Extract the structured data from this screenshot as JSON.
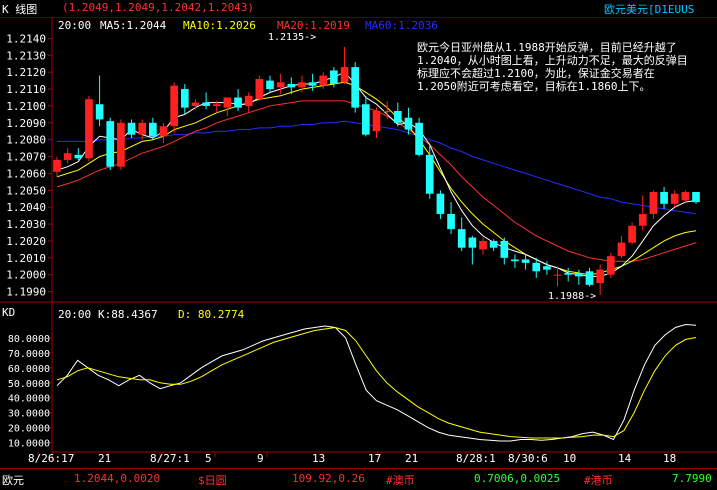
{
  "window": {
    "title": "K 线图",
    "ohlc_readout": "(1.2049,1.2049,1.2042,1.2043)",
    "symbol": "欧元美元[D1EUUS"
  },
  "main_panel": {
    "time_label": "20:00",
    "ma5_label": "MA5:1.2044",
    "ma10_label": "MA10:1.2026",
    "ma20_label": "MA20:1.2019",
    "ma60_label": "MA60:1.2036",
    "high_annotation": "1.2135->",
    "low_annotation": "1.1988->",
    "note": "欧元今日亚州盘从1.1988开始反弹，目前已经升越了1.2040，从小时图上看，上升动力不足，最大的反弹目标理应不会超过1.2100，为此，保证金交易者在1.2050附近可考虑看空，目标在1.1860上下。"
  },
  "kd_panel": {
    "title": "KD",
    "time_label": "20:00",
    "k_label": "K:88.4367",
    "d_label": "D: 80.2774"
  },
  "x_axis_labels": [
    "8/26:17",
    "21",
    "8/27:1",
    "5",
    "9",
    "13",
    "17",
    "21",
    "8/28:1",
    "8/30:6",
    "10",
    "14",
    "18"
  ],
  "status_bar": {
    "items": [
      {
        "name": "欧元",
        "value": "1.2044,0.0020",
        "color": "#ff3030"
      },
      {
        "name": "$日圆",
        "value": "109.92,0.26",
        "color": "#ff3030"
      },
      {
        "name": "#澳币",
        "value": "0.7006,0.0025",
        "color": "#30ff30"
      },
      {
        "name": "#港币",
        "value": "7.7990",
        "color": "#30ff30"
      }
    ]
  },
  "colors": {
    "up": "#ff2020",
    "down": "#20ffff",
    "ma5": "#ffffff",
    "ma10": "#ffff00",
    "ma20": "#ff3030",
    "ma60": "#2030ff",
    "axis": "#a00000"
  },
  "chart_data": [
    {
      "type": "candlestick",
      "title": "K 线图",
      "y_ticks": [
        1.214,
        1.213,
        1.212,
        1.211,
        1.21,
        1.209,
        1.208,
        1.207,
        1.206,
        1.205,
        1.204,
        1.203,
        1.202,
        1.201,
        1.2,
        1.199
      ],
      "ylim": [
        1.1985,
        1.2145
      ],
      "candles": [
        {
          "o": 1.2061,
          "h": 1.207,
          "l": 1.2058,
          "c": 1.2068
        },
        {
          "o": 1.2068,
          "h": 1.2075,
          "l": 1.2066,
          "c": 1.2072
        },
        {
          "o": 1.2071,
          "h": 1.2075,
          "l": 1.2068,
          "c": 1.2069
        },
        {
          "o": 1.2069,
          "h": 1.2106,
          "l": 1.2067,
          "c": 1.2104
        },
        {
          "o": 1.2101,
          "h": 1.2118,
          "l": 1.2088,
          "c": 1.2092
        },
        {
          "o": 1.2091,
          "h": 1.2093,
          "l": 1.2062,
          "c": 1.2064
        },
        {
          "o": 1.2064,
          "h": 1.2092,
          "l": 1.2062,
          "c": 1.209
        },
        {
          "o": 1.209,
          "h": 1.2092,
          "l": 1.2081,
          "c": 1.2083
        },
        {
          "o": 1.2083,
          "h": 1.2092,
          "l": 1.208,
          "c": 1.209
        },
        {
          "o": 1.209,
          "h": 1.2093,
          "l": 1.208,
          "c": 1.2082
        },
        {
          "o": 1.2082,
          "h": 1.209,
          "l": 1.2078,
          "c": 1.2088
        },
        {
          "o": 1.2088,
          "h": 1.2114,
          "l": 1.2084,
          "c": 1.2112
        },
        {
          "o": 1.211,
          "h": 1.2113,
          "l": 1.2095,
          "c": 1.2099
        },
        {
          "o": 1.21,
          "h": 1.2104,
          "l": 1.2098,
          "c": 1.2102
        },
        {
          "o": 1.2102,
          "h": 1.2108,
          "l": 1.2098,
          "c": 1.21
        },
        {
          "o": 1.21,
          "h": 1.2103,
          "l": 1.2096,
          "c": 1.2101
        },
        {
          "o": 1.2099,
          "h": 1.2104,
          "l": 1.2094,
          "c": 1.2105
        },
        {
          "o": 1.2105,
          "h": 1.211,
          "l": 1.2097,
          "c": 1.2099
        },
        {
          "o": 1.21,
          "h": 1.2108,
          "l": 1.2096,
          "c": 1.2106
        },
        {
          "o": 1.2104,
          "h": 1.2118,
          "l": 1.2103,
          "c": 1.2116
        },
        {
          "o": 1.2115,
          "h": 1.2118,
          "l": 1.2108,
          "c": 1.211
        },
        {
          "o": 1.2111,
          "h": 1.2119,
          "l": 1.2107,
          "c": 1.2114
        },
        {
          "o": 1.2113,
          "h": 1.2117,
          "l": 1.2107,
          "c": 1.2111
        },
        {
          "o": 1.2111,
          "h": 1.2118,
          "l": 1.2108,
          "c": 1.2114
        },
        {
          "o": 1.2114,
          "h": 1.2119,
          "l": 1.2109,
          "c": 1.2112
        },
        {
          "o": 1.2112,
          "h": 1.212,
          "l": 1.211,
          "c": 1.2118
        },
        {
          "o": 1.2121,
          "h": 1.2123,
          "l": 1.2111,
          "c": 1.2113
        },
        {
          "o": 1.2114,
          "h": 1.2135,
          "l": 1.2113,
          "c": 1.2123
        },
        {
          "o": 1.2123,
          "h": 1.2126,
          "l": 1.2096,
          "c": 1.2099
        },
        {
          "o": 1.2101,
          "h": 1.2106,
          "l": 1.2082,
          "c": 1.2083
        },
        {
          "o": 1.2085,
          "h": 1.2099,
          "l": 1.2081,
          "c": 1.2097
        },
        {
          "o": 1.2097,
          "h": 1.2103,
          "l": 1.2092,
          "c": 1.2097
        },
        {
          "o": 1.2097,
          "h": 1.2102,
          "l": 1.2088,
          "c": 1.209
        },
        {
          "o": 1.2093,
          "h": 1.2099,
          "l": 1.2083,
          "c": 1.2086
        },
        {
          "o": 1.209,
          "h": 1.2093,
          "l": 1.207,
          "c": 1.2071
        },
        {
          "o": 1.2071,
          "h": 1.2077,
          "l": 1.2045,
          "c": 1.2048
        },
        {
          "o": 1.2048,
          "h": 1.205,
          "l": 1.2033,
          "c": 1.2036
        },
        {
          "o": 1.2036,
          "h": 1.2043,
          "l": 1.2024,
          "c": 1.2027
        },
        {
          "o": 1.2027,
          "h": 1.2034,
          "l": 1.2014,
          "c": 1.2016
        },
        {
          "o": 1.2022,
          "h": 1.2023,
          "l": 1.2006,
          "c": 1.2016
        },
        {
          "o": 1.2015,
          "h": 1.2022,
          "l": 1.2012,
          "c": 1.202
        },
        {
          "o": 1.202,
          "h": 1.2021,
          "l": 1.2014,
          "c": 1.2016
        },
        {
          "o": 1.202,
          "h": 1.2022,
          "l": 1.2006,
          "c": 1.201
        },
        {
          "o": 1.2009,
          "h": 1.2012,
          "l": 1.2004,
          "c": 1.2008
        },
        {
          "o": 1.2009,
          "h": 1.2012,
          "l": 1.2003,
          "c": 1.2007
        },
        {
          "o": 1.2007,
          "h": 1.201,
          "l": 1.1998,
          "c": 1.2002
        },
        {
          "o": 1.2005,
          "h": 1.2008,
          "l": 1.2,
          "c": 1.2003
        },
        {
          "o": 1.2,
          "h": 1.2005,
          "l": 1.1993,
          "c": 1.2
        },
        {
          "o": 1.2001,
          "h": 1.2004,
          "l": 1.1996,
          "c": 1.2
        },
        {
          "o": 1.2001,
          "h": 1.2003,
          "l": 1.1994,
          "c": 1.1999
        },
        {
          "o": 1.2002,
          "h": 1.2004,
          "l": 1.1993,
          "c": 1.1994
        },
        {
          "o": 1.1995,
          "h": 1.2006,
          "l": 1.1988,
          "c": 1.2003
        },
        {
          "o": 1.2,
          "h": 1.2013,
          "l": 1.1998,
          "c": 1.2011
        },
        {
          "o": 1.2011,
          "h": 1.2023,
          "l": 1.201,
          "c": 1.2019
        },
        {
          "o": 1.2019,
          "h": 1.2031,
          "l": 1.2018,
          "c": 1.2029
        },
        {
          "o": 1.2029,
          "h": 1.2047,
          "l": 1.2026,
          "c": 1.2036
        },
        {
          "o": 1.2036,
          "h": 1.205,
          "l": 1.2033,
          "c": 1.2049
        },
        {
          "o": 1.2049,
          "h": 1.2052,
          "l": 1.2039,
          "c": 1.2042
        },
        {
          "o": 1.2042,
          "h": 1.205,
          "l": 1.204,
          "c": 1.2048
        },
        {
          "o": 1.2044,
          "h": 1.205,
          "l": 1.2042,
          "c": 1.2049
        },
        {
          "o": 1.2049,
          "h": 1.2049,
          "l": 1.2042,
          "c": 1.2043
        }
      ],
      "ma5": [
        1.2062,
        1.2064,
        1.2067,
        1.2076,
        1.2082,
        1.2081,
        1.208,
        1.2086,
        1.2083,
        1.2081,
        1.2085,
        1.2093,
        1.2095,
        1.2099,
        1.2102,
        1.2102,
        1.2102,
        1.2101,
        1.2101,
        1.2105,
        1.2108,
        1.211,
        1.2112,
        1.2113,
        1.2113,
        1.2115,
        1.2117,
        1.212,
        1.2113,
        1.2105,
        1.2101,
        1.2095,
        1.2089,
        1.209,
        1.2086,
        1.2077,
        1.2063,
        1.2049,
        1.2038,
        1.2029,
        1.2023,
        1.2019,
        1.2016,
        1.2014,
        1.2012,
        1.2009,
        1.2006,
        1.2004,
        1.2001,
        1.2,
        1.1999,
        1.1999,
        1.2001,
        1.2005,
        1.2011,
        1.202,
        1.2029,
        1.2035,
        1.204,
        1.2043,
        1.2044
      ],
      "ma10": [
        1.2058,
        1.206,
        1.2062,
        1.2066,
        1.207,
        1.2072,
        1.2073,
        1.2076,
        1.2079,
        1.208,
        1.2082,
        1.2086,
        1.2088,
        1.209,
        1.2093,
        1.2096,
        1.2098,
        1.21,
        1.2102,
        1.2104,
        1.2105,
        1.2106,
        1.2108,
        1.211,
        1.2111,
        1.2112,
        1.2113,
        1.2114,
        1.2112,
        1.2108,
        1.2104,
        1.2099,
        1.2093,
        1.2088,
        1.208,
        1.2071,
        1.2061,
        1.2051,
        1.2043,
        1.2036,
        1.203,
        1.2025,
        1.202,
        1.2016,
        1.2012,
        1.2009,
        1.2006,
        1.2004,
        1.2002,
        1.2001,
        1.2,
        1.2001,
        1.2003,
        1.2005,
        1.2008,
        1.2012,
        1.2016,
        1.202,
        1.2023,
        1.2025,
        1.2026
      ],
      "ma20": [
        1.2052,
        1.2054,
        1.2056,
        1.2059,
        1.2062,
        1.2064,
        1.2066,
        1.2069,
        1.2072,
        1.2074,
        1.2076,
        1.2079,
        1.2082,
        1.2085,
        1.2087,
        1.209,
        1.2092,
        1.2094,
        1.2096,
        1.2098,
        1.21,
        1.2101,
        1.2102,
        1.2103,
        1.2103,
        1.2103,
        1.2103,
        1.2103,
        1.2101,
        1.2099,
        1.2097,
        1.2094,
        1.209,
        1.2086,
        1.2082,
        1.2077,
        1.2071,
        1.2065,
        1.2058,
        1.2052,
        1.2046,
        1.2041,
        1.2036,
        1.2031,
        1.2027,
        1.2023,
        1.202,
        1.2017,
        1.2014,
        1.2012,
        1.201,
        1.2009,
        1.2008,
        1.2008,
        1.2008,
        1.2009,
        1.2011,
        1.2013,
        1.2015,
        1.2017,
        1.2019
      ],
      "ma60": [
        1.2079,
        1.2079,
        1.2079,
        1.2079,
        1.208,
        1.208,
        1.208,
        1.2081,
        1.2081,
        1.2082,
        1.2082,
        1.2083,
        1.2083,
        1.2084,
        1.2084,
        1.2085,
        1.2085,
        1.2086,
        1.2086,
        1.2087,
        1.2087,
        1.2088,
        1.2088,
        1.2089,
        1.2089,
        1.209,
        1.209,
        1.2091,
        1.209,
        1.2089,
        1.2088,
        1.2087,
        1.2086,
        1.2084,
        1.2082,
        1.208,
        1.2078,
        1.2075,
        1.2073,
        1.207,
        1.2068,
        1.2066,
        1.2064,
        1.2062,
        1.206,
        1.2058,
        1.2056,
        1.2054,
        1.2052,
        1.205,
        1.2048,
        1.2046,
        1.2045,
        1.2043,
        1.2042,
        1.2041,
        1.204,
        1.2039,
        1.2038,
        1.2037,
        1.2036
      ]
    },
    {
      "type": "line",
      "title": "KD",
      "y_ticks": [
        80,
        70,
        60,
        50,
        40,
        30,
        20,
        10
      ],
      "ylim": [
        5,
        92
      ],
      "series": [
        {
          "name": "K",
          "color": "#ffffff",
          "values": [
            48,
            55,
            65,
            60,
            55,
            52,
            48,
            52,
            55,
            50,
            46,
            48,
            50,
            55,
            60,
            64,
            68,
            70,
            72,
            75,
            78,
            80,
            82,
            84,
            86,
            87,
            88,
            87,
            80,
            62,
            45,
            38,
            35,
            32,
            28,
            24,
            20,
            17,
            15,
            14,
            13,
            12,
            11.5,
            11,
            11,
            12,
            12,
            11.5,
            12,
            13,
            14,
            16,
            17,
            15,
            12,
            25,
            45,
            62,
            75,
            82,
            87,
            89,
            88.4367
          ]
        },
        {
          "name": "D",
          "color": "#ffff00",
          "values": [
            52,
            54,
            58,
            60,
            58,
            56,
            54,
            53,
            52,
            52,
            50,
            49,
            49,
            51,
            54,
            58,
            62,
            65,
            68,
            71,
            74,
            77,
            79,
            81,
            83,
            85,
            86,
            87,
            85,
            78,
            68,
            58,
            50,
            44,
            39,
            34,
            30,
            26,
            23,
            21,
            19,
            17,
            16,
            15,
            14,
            13.5,
            13,
            13,
            13,
            13,
            13.5,
            14,
            15,
            15,
            14,
            18,
            30,
            45,
            58,
            68,
            75,
            79,
            80.2774
          ]
        }
      ]
    }
  ]
}
